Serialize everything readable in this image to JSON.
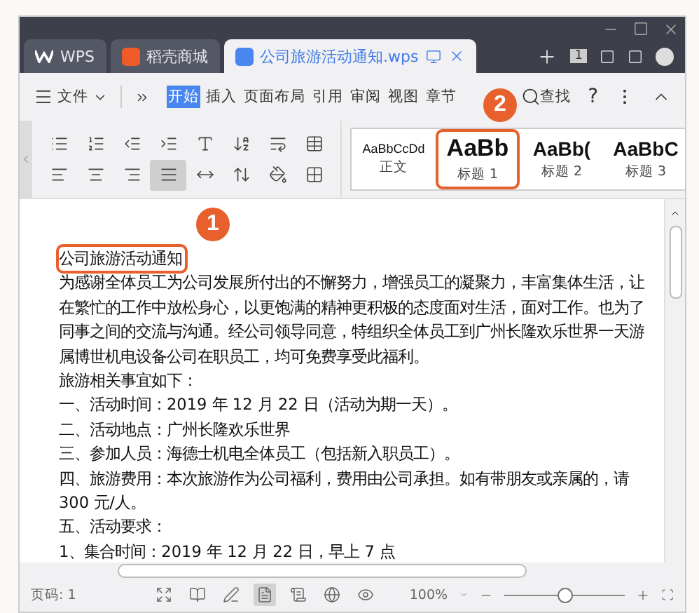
{
  "tabs": [
    {
      "label": "WPS",
      "selected": false,
      "kind": "home"
    },
    {
      "label": "稻壳商城",
      "selected": false,
      "kind": "store"
    },
    {
      "label": "公司旅游活动通知.wps",
      "selected": true,
      "kind": "doc"
    }
  ],
  "title_bar": {
    "window_count": "1"
  },
  "menu": {
    "file": "文件",
    "items": [
      {
        "label": "开始",
        "selected": true
      },
      {
        "label": "插入",
        "selected": false
      },
      {
        "label": "页面布局",
        "selected": false
      },
      {
        "label": "引用",
        "selected": false
      },
      {
        "label": "审阅",
        "selected": false
      },
      {
        "label": "视图",
        "selected": false
      },
      {
        "label": "章节",
        "selected": false
      }
    ],
    "search": "查找",
    "help": "?"
  },
  "ribbon": {
    "justify_selected": true
  },
  "styles": [
    {
      "preview": "AaBbCcDd",
      "label": "正文",
      "selected": false,
      "kind": "body"
    },
    {
      "preview": "AaBb",
      "label": "标题 1",
      "selected": true,
      "kind": "h1"
    },
    {
      "preview": "AaBb(",
      "label": "标题 2",
      "selected": false,
      "kind": "h2"
    },
    {
      "preview": "AaBbC",
      "label": "标题 3",
      "selected": false,
      "kind": "h3"
    }
  ],
  "callouts": [
    {
      "number": "1"
    },
    {
      "number": "2"
    }
  ],
  "document": {
    "paragraphs": [
      {
        "text": "公司旅游活动通知",
        "highlighted": true
      },
      {
        "text": "为感谢全体员工为公司发展所付出的不懈努力，增强员工的凝聚力，丰富集体生活，让",
        "highlighted": false
      },
      {
        "text": "在繁忙的工作中放松身心，以更饱满的精神更积极的态度面对生活，面对工作。也为了",
        "highlighted": false
      },
      {
        "text": "同事之间的交流与沟通。经公司领导同意，特组织全体员工到广州长隆欢乐世界一天游",
        "highlighted": false
      },
      {
        "text": "属博世机电设备公司在职员工，均可免费享受此福利。",
        "highlighted": false
      },
      {
        "text": "旅游相关事宜如下：",
        "highlighted": false
      },
      {
        "text": "一、活动时间：2019 年 12 月 22 日（活动为期一天）。",
        "highlighted": false
      },
      {
        "text": "二、活动地点：广州长隆欢乐世界",
        "highlighted": false
      },
      {
        "text": "三、参加人员：海德士机电全体员工（包括新入职员工）。",
        "highlighted": false
      },
      {
        "text": "四、旅游费用：本次旅游作为公司福利，费用由公司承担。如有带朋友或亲属的，请",
        "highlighted": false
      },
      {
        "text": "300 元/人。",
        "highlighted": false
      },
      {
        "text": "五、活动要求：",
        "highlighted": false
      },
      {
        "text": "1、集合时间：2019 年 12 月 22 日，早上 7 点",
        "highlighted": false
      }
    ]
  },
  "status_bar": {
    "page": "页码: 1",
    "views": [
      {
        "selected": false
      },
      {
        "selected": false
      },
      {
        "selected": false
      },
      {
        "selected": true
      },
      {
        "selected": false
      },
      {
        "selected": false
      },
      {
        "selected": false
      }
    ],
    "zoom": "100%",
    "level": 0.5
  }
}
